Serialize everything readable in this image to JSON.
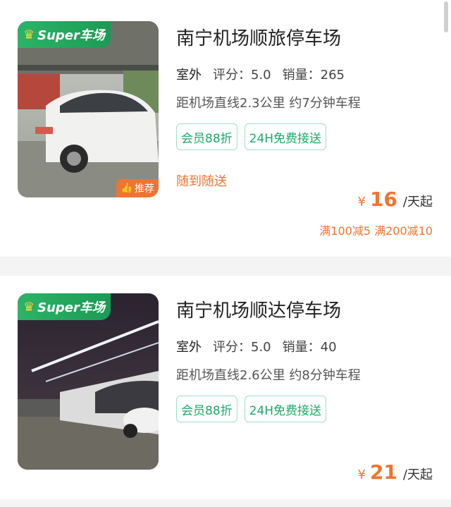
{
  "listings": [
    {
      "badge": "Super车场",
      "recommend": "推荐",
      "title": "南宁机场顺旅停车场",
      "type": "室外",
      "rating": "评分：5.0",
      "sales": "销量：265",
      "distance": "距机场直线2.3公里 约7分钟车程",
      "tags": [
        "会员88折",
        "24H免费接送"
      ],
      "pickup": "随到随送",
      "price_symbol": "¥",
      "price": "16",
      "price_unit": "/天起",
      "discount": "满100减5 满200减10"
    },
    {
      "badge": "Super车场",
      "title": "南宁机场顺达停车场",
      "type": "室外",
      "rating": "评分：5.0",
      "sales": "销量：40",
      "distance": "距机场直线2.6公里 约8分钟车程",
      "tags": [
        "会员88折",
        "24H免费接送"
      ],
      "price_symbol": "¥",
      "price": "21",
      "price_unit": "/天起"
    }
  ],
  "colors": {
    "brand": "#1ea86d",
    "accent": "#f07430"
  },
  "icons": {
    "crown": "crown-icon",
    "thumbs_up": "thumbs-up-icon"
  }
}
